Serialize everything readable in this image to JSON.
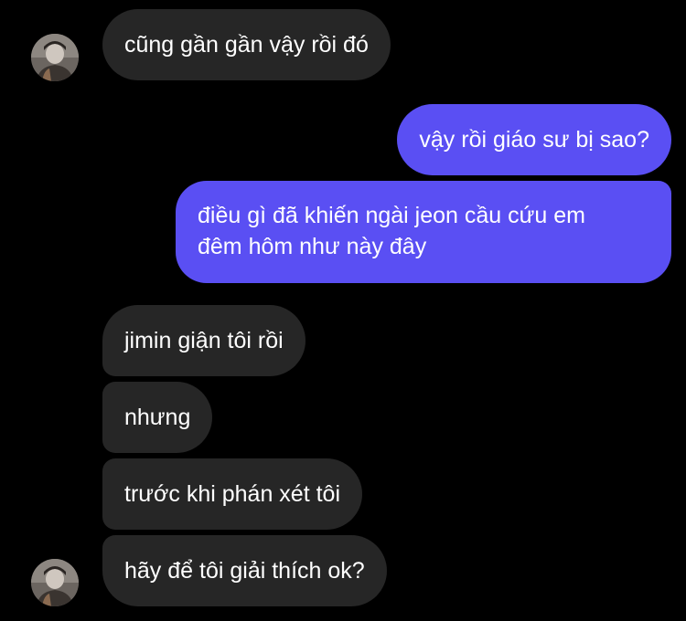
{
  "chat": {
    "messages": [
      {
        "side": "incoming",
        "text": "cũng gần gần vậy rồi đó"
      },
      {
        "side": "outgoing",
        "text": "vậy rồi giáo sư bị sao?"
      },
      {
        "side": "outgoing",
        "line1": "điều gì đã khiến ngài jeon cầu cứu em",
        "line2": "đêm hôm như này đây"
      },
      {
        "side": "incoming",
        "text": "jimin giận tôi rồi"
      },
      {
        "side": "incoming",
        "text": "nhưng"
      },
      {
        "side": "incoming",
        "text": "trước khi phán xét tôi"
      },
      {
        "side": "incoming",
        "text": "hãy để tôi giải thích ok?"
      }
    ]
  },
  "colors": {
    "background": "#000000",
    "incoming_bubble": "#262626",
    "outgoing_bubble": "#5a4ff3",
    "text": "#ffffff"
  },
  "icons": {
    "avatar": "contact-avatar-icon"
  }
}
